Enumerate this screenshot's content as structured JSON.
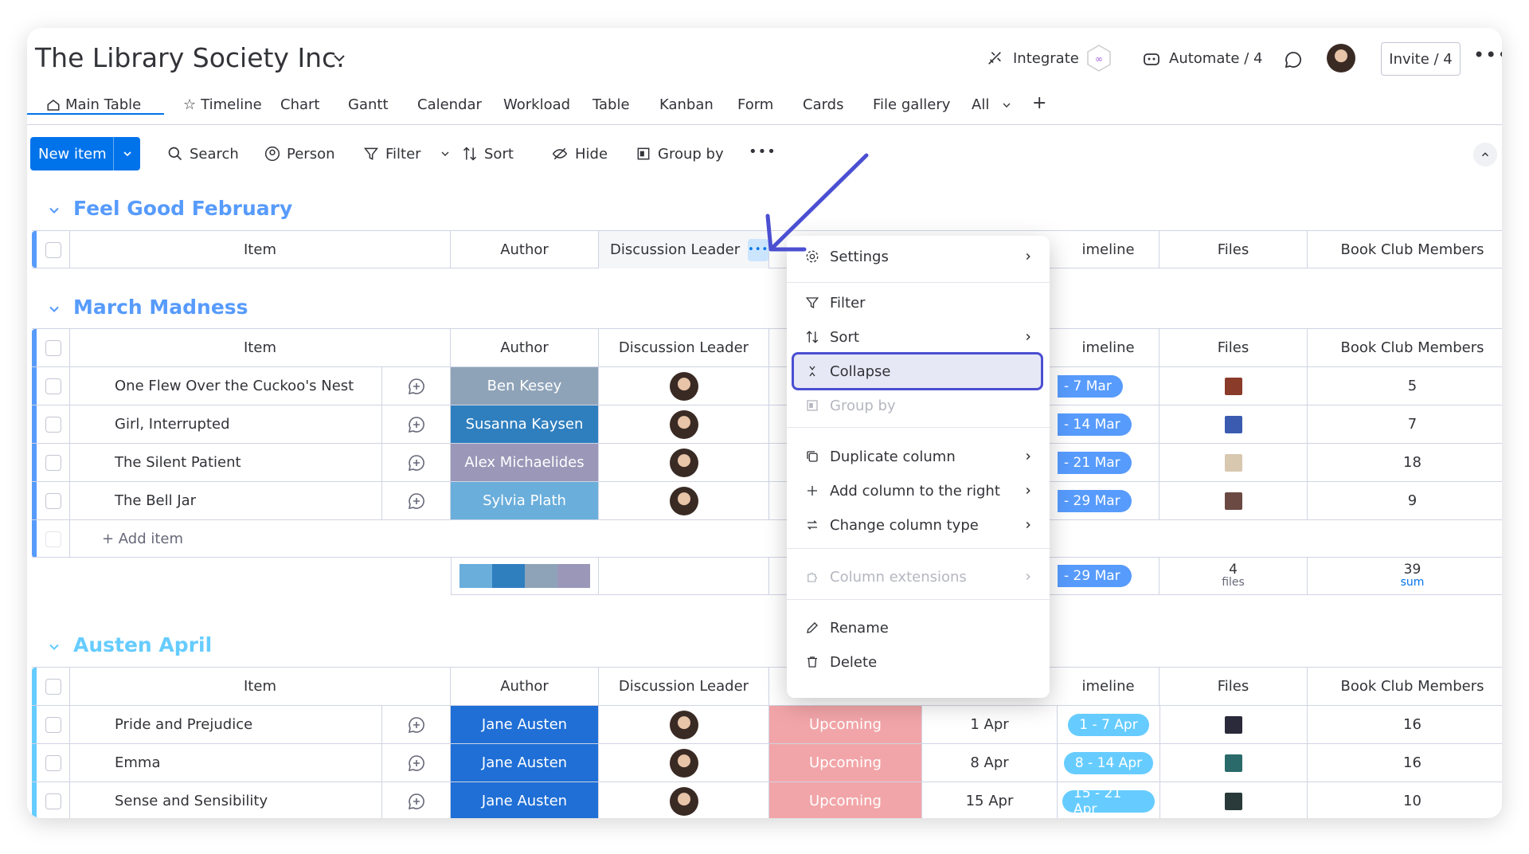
{
  "board": {
    "title": "The Library Society Inc."
  },
  "header": {
    "integrate": "Integrate",
    "automate": "Automate / 4",
    "invite": "Invite / 4"
  },
  "tabs": [
    "Main Table",
    "Timeline",
    "Chart",
    "Gantt",
    "Calendar",
    "Workload",
    "Table",
    "Kanban",
    "Form",
    "Cards",
    "File gallery",
    "All"
  ],
  "toolbar": {
    "new_item": "New item",
    "search": "Search",
    "person": "Person",
    "filter": "Filter",
    "sort": "Sort",
    "hide": "Hide",
    "group_by": "Group by"
  },
  "columns": {
    "item": "Item",
    "author": "Author",
    "discussion_leader": "Discussion Leader",
    "timeline": "imeline",
    "files": "Files",
    "members": "Book Club Members"
  },
  "groups": [
    {
      "title": "Feel Good February",
      "color": "#579bfc",
      "rows": []
    },
    {
      "title": "March Madness",
      "color": "#579bfc",
      "add_item": "+ Add item",
      "rows": [
        {
          "item": "One Flew Over the Cuckoo's Nest",
          "author": "Ben Kesey",
          "author_color": "#8fa3b8",
          "timeline": "- 7 Mar",
          "file_color": "#8a3b2a",
          "members": "5"
        },
        {
          "item": "Girl, Interrupted",
          "author": "Susanna Kaysen",
          "author_color": "#2f7fbf",
          "timeline": "- 14 Mar",
          "file_color": "#3a5bb0",
          "members": "7"
        },
        {
          "item": "The Silent Patient",
          "author": "Alex Michaelides",
          "author_color": "#9b97b8",
          "timeline": "- 21 Mar",
          "file_color": "#d8c8b0",
          "members": "18"
        },
        {
          "item": "The Bell Jar",
          "author": "Sylvia Plath",
          "author_color": "#6aaedb",
          "timeline": "- 29 Mar",
          "file_color": "#6b4a44",
          "members": "9"
        }
      ],
      "summary": {
        "timeline": "- 29 Mar",
        "files_count": "4",
        "files_label": "files",
        "members_sum": "39",
        "members_label": "sum",
        "author_colors": [
          "#6aaedb",
          "#2f7fbf",
          "#8fa3b8",
          "#9b97b8"
        ]
      }
    },
    {
      "title": "Austen April",
      "color": "#66ccff",
      "rows": [
        {
          "item": "Pride and Prejudice",
          "author": "Jane Austen",
          "author_color": "#1f6fd6",
          "status": "Upcoming",
          "date": "1 Apr",
          "timeline": "1 - 7 Apr",
          "file_color": "#2a2a3a",
          "members": "16"
        },
        {
          "item": "Emma",
          "author": "Jane Austen",
          "author_color": "#1f6fd6",
          "status": "Upcoming",
          "date": "8 Apr",
          "timeline": "8 - 14 Apr",
          "file_color": "#2a6a6a",
          "members": "16"
        },
        {
          "item": "Sense and Sensibility",
          "author": "Jane Austen",
          "author_color": "#1f6fd6",
          "status": "Upcoming",
          "date": "15 Apr",
          "timeline": "15 - 21 Apr",
          "file_color": "#2a3a3a",
          "members": "10"
        }
      ]
    }
  ],
  "menu": {
    "settings": "Settings",
    "filter": "Filter",
    "sort": "Sort",
    "collapse": "Collapse",
    "group_by": "Group by",
    "duplicate": "Duplicate column",
    "add_right": "Add column to the right",
    "change_type": "Change column type",
    "extensions": "Column extensions",
    "rename": "Rename",
    "delete": "Delete"
  },
  "colors": {
    "accent": "#0073ea",
    "status_upcoming": "#f2a5a8",
    "timeline": "#579bfc",
    "highlight": "#4b4fd1"
  }
}
